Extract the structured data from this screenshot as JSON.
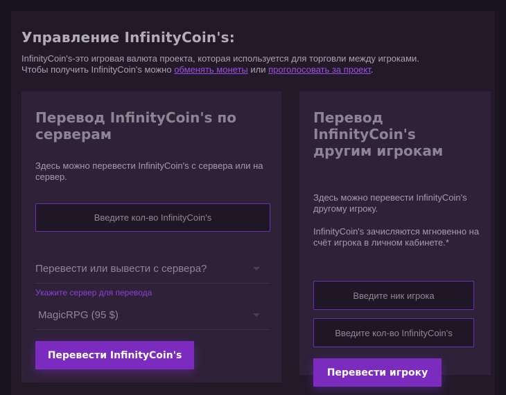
{
  "page": {
    "title": "Управление InfinityCoin's:",
    "intro_line1": "InfinityCoin's-это игровая валюта проекта, которая используется для торговли между игроками.",
    "intro_line2_prefix": "Чтобы получить InfinityCoin's можно ",
    "link_exchange": "обменять монеты",
    "intro_or": " или ",
    "link_vote": "проголосовать за проект",
    "intro_end": "."
  },
  "server_transfer": {
    "title": "Перевод InfinityCoin's по серверам",
    "description": "Здесь можно перевести InfinityCoin's с сервера или на сервер.",
    "amount_placeholder": "Введите кол-во InfinityCoin's",
    "direction_select": "Перевести или вывести с сервера?",
    "server_label": "Укажите сервер для перевода",
    "server_select": "MagicRPG (95 $)",
    "button_label": "Перевести InfinityCoin's"
  },
  "player_transfer": {
    "title": "Перевод InfinityCoin's другим игрокам",
    "description1": "Здесь можно перевести InfinityCoin's другому игроку.",
    "description2": "InfinityCoin's зачисляются мгновенно на счёт игрока в личном кабинете.*",
    "nick_placeholder": "Введите ник игрока",
    "amount_placeholder": "Введите кол-во InfinityCoin's",
    "button_label": "Перевести игроку"
  },
  "colors": {
    "accent": "#7b2cbf",
    "link": "#9a4fe0",
    "card_bg": "#2f2138",
    "page_bg": "#1a1420"
  }
}
